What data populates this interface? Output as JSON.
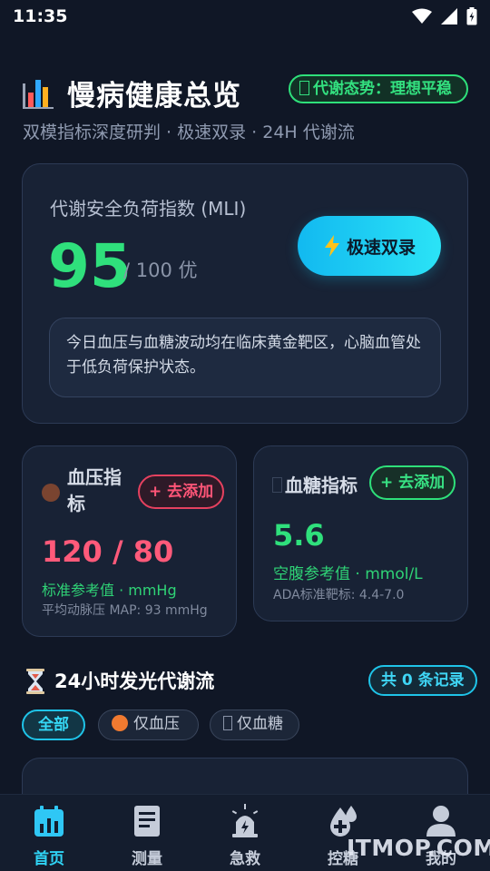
{
  "status_bar": {
    "time": "11:35"
  },
  "header": {
    "title": "慢病健康总览",
    "status_chip": "代谢态势：理想平稳",
    "subtitle": "双模指标深度研判 · 极速双录 · 24H 代谢流"
  },
  "mli_card": {
    "label": "代谢安全负荷指数 (MLI)",
    "score": "95",
    "max_text": "/ 100 优",
    "quick_button": "极速双录",
    "note": "今日血压与血糖波动均在临床黄金靶区，心脑血管处于低负荷保护状态。"
  },
  "bp_card": {
    "title": "血压指标",
    "add_button": "+ 去添加",
    "value": "120 / 80",
    "ref": "标准参考值 · mmHg",
    "sub": "平均动脉压 MAP: 93 mmHg"
  },
  "bg_card": {
    "title": "血糖指标",
    "add_button": "+ 去添加",
    "value": "5.6",
    "ref": "空腹参考值 · mmol/L",
    "sub": "ADA标准靶标: 4.4-7.0"
  },
  "flow": {
    "title": "24小时发光代谢流",
    "count_badge": "共 0 条记录",
    "filters": [
      "全部",
      "仅血压",
      "仅血糖"
    ]
  },
  "bottom_nav": {
    "items": [
      "首页",
      "测量",
      "急救",
      "控糖",
      "我的"
    ]
  },
  "watermark": "ITMOP.COM",
  "colors": {
    "background": "#101726",
    "card": "#182235",
    "accent_cyan": "#1fc4e8",
    "accent_green": "#2fe07c",
    "accent_red": "#ff5a7a"
  }
}
